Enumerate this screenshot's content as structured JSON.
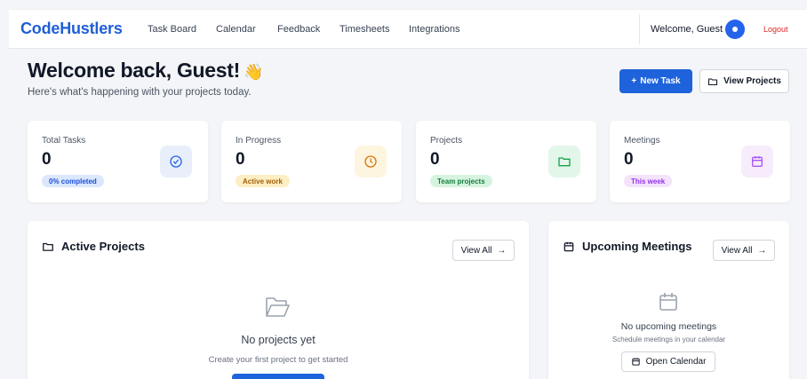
{
  "navbar": {
    "brand": "CodeHustlers",
    "links": [
      "Task Board",
      "Calendar",
      "Feedback",
      "Timesheets",
      "Integrations"
    ],
    "welcome": "Welcome, Guest",
    "logout": "Logout"
  },
  "header": {
    "title": "Welcome back, Guest!",
    "subtitle": "Here's what's happening with your projects today.",
    "new_task": "New Task",
    "view_projects": "View Projects"
  },
  "stats": [
    {
      "label": "Total Tasks",
      "value": "0",
      "badge": "0% completed",
      "icon": "check-circle-icon"
    },
    {
      "label": "In Progress",
      "value": "0",
      "badge": "Active work",
      "icon": "clock-icon"
    },
    {
      "label": "Projects",
      "value": "0",
      "badge": "Team projects",
      "icon": "folder-icon"
    },
    {
      "label": "Meetings",
      "value": "0",
      "badge": "This week",
      "icon": "calendar-icon"
    }
  ],
  "active_projects": {
    "title": "Active Projects",
    "view_all": "View All",
    "empty_title": "No projects yet",
    "empty_sub": "Create your first project to get started"
  },
  "upcoming_meetings": {
    "title": "Upcoming Meetings",
    "view_all": "View All",
    "empty_title": "No upcoming meetings",
    "empty_sub": "Schedule meetings in your calendar",
    "open_calendar": "Open Calendar"
  },
  "colors": {
    "primary": "#1e63db",
    "brand": "#1f5fd6",
    "logout": "#dc2626",
    "blue_badge_bg": "#dbe7fb",
    "blue_badge_fg": "#1d4ed8",
    "yellow_badge_bg": "#fdeec4",
    "yellow_badge_fg": "#a16207",
    "green_badge_bg": "#d6f3e0",
    "green_badge_fg": "#15803d",
    "purple_badge_bg": "#f3e3fb",
    "purple_badge_fg": "#9333ea"
  }
}
